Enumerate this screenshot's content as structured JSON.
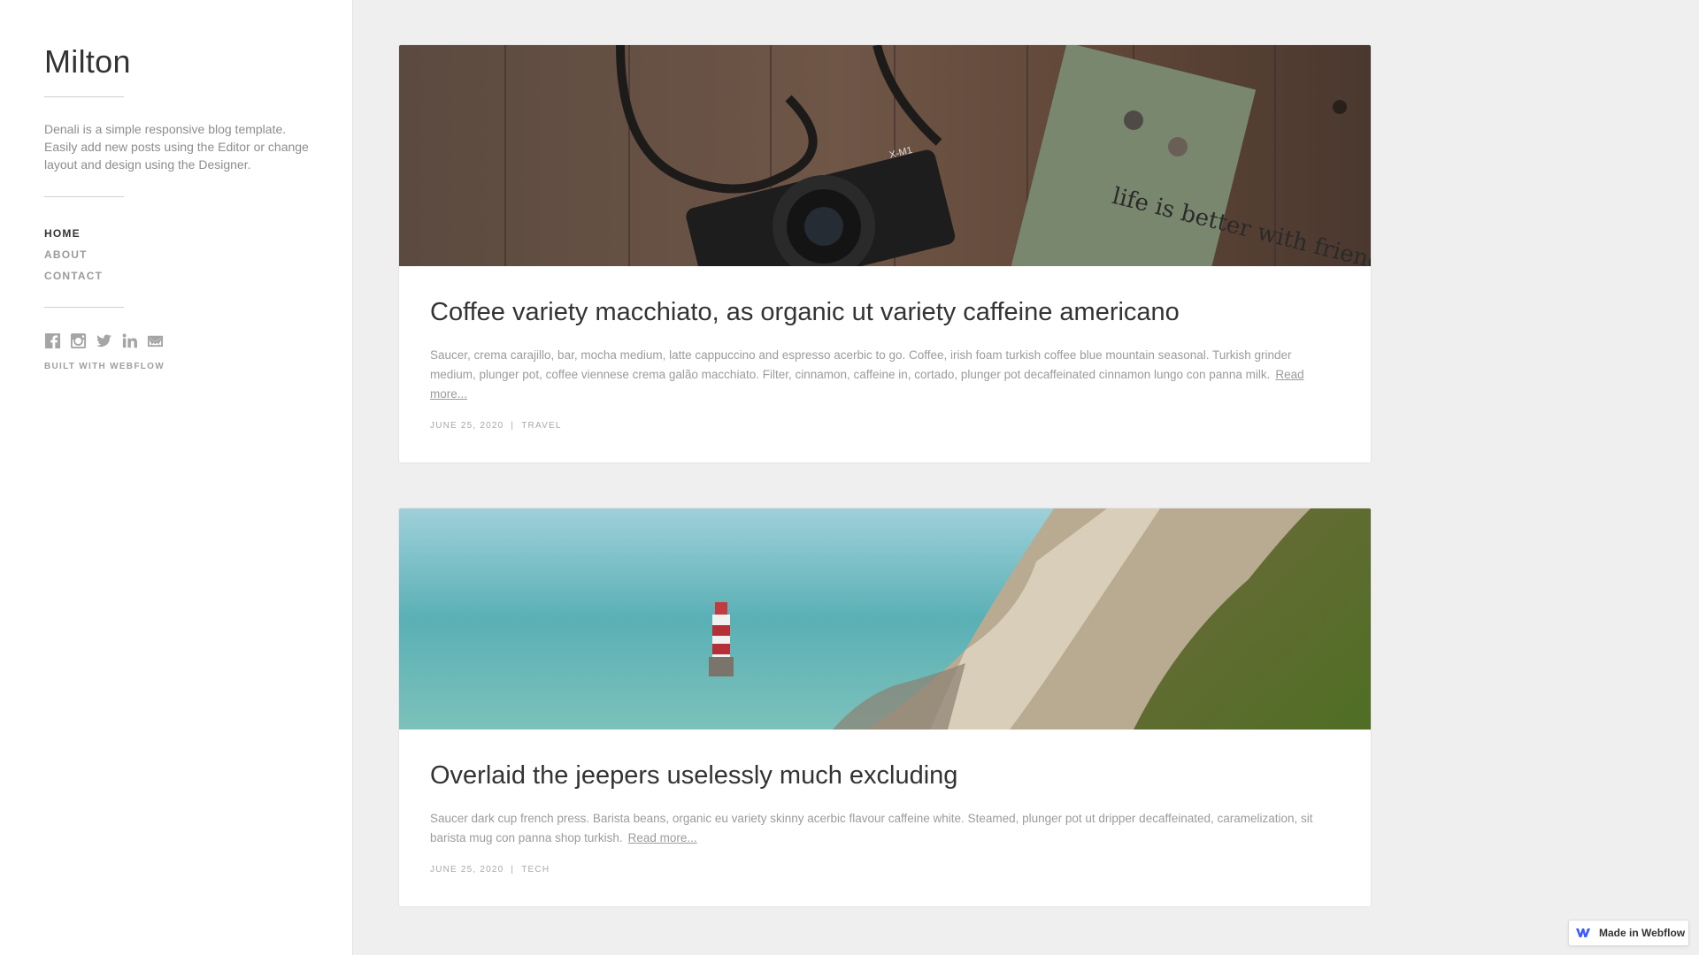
{
  "sidebar": {
    "title": "Milton",
    "description": "Denali is a simple responsive blog template. Easily add new posts using the Editor or change layout and design using the Designer.",
    "nav": [
      {
        "label": "HOME",
        "active": true
      },
      {
        "label": "ABOUT",
        "active": false
      },
      {
        "label": "CONTACT",
        "active": false
      }
    ],
    "social_icons": [
      "facebook-icon",
      "instagram-icon",
      "twitter-icon",
      "linkedin-icon",
      "mail-icon"
    ],
    "built_with": "BUILT WITH WEBFLOW"
  },
  "posts": [
    {
      "title": "Coffee variety macchiato, as organic ut variety caffeine americano",
      "excerpt": "Saucer, crema carajillo, bar, mocha medium, latte cappuccino and espresso acerbic to go. Coffee, irish foam turkish coffee blue mountain seasonal. Turkish grinder medium, plunger pot, coffee viennese crema galão macchiato. Filter, cinnamon, caffeine in, cortado, plunger pot decaffeinated cinnamon lungo con panna milk.",
      "read_more": "Read more...",
      "date": "JUNE 25, 2020",
      "category": "TRAVEL",
      "image_caption": "life is better with friends",
      "camera_model": "X-M1"
    },
    {
      "title": "Overlaid the jeepers uselessly much excluding",
      "excerpt": "Saucer dark cup french press. Barista beans, organic eu variety skinny acerbic flavour caffeine white. Steamed, plunger pot ut dripper decaffeinated, caramelization, sit barista mug con panna shop turkish.",
      "read_more": "Read more...",
      "date": "JUNE 25, 2020",
      "category": "TECH"
    }
  ],
  "meta_separator": "|",
  "badge": {
    "label": "Made in Webflow"
  },
  "colors": {
    "sidebar_bg": "#ffffff",
    "page_bg": "#efefef",
    "title": "#333333",
    "muted": "#9b9b9b"
  }
}
